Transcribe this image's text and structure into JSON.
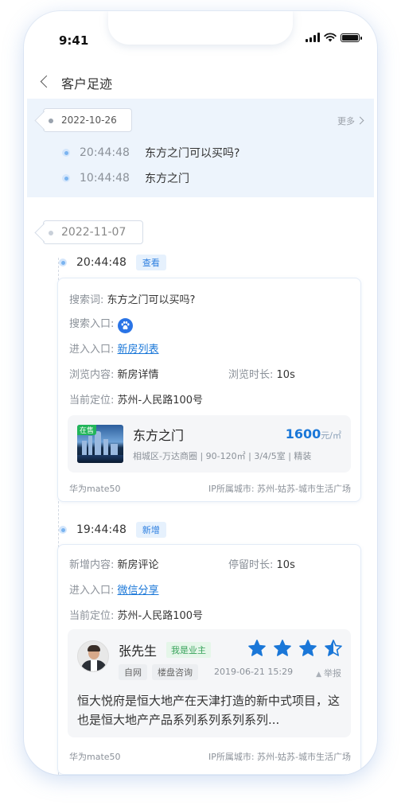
{
  "status": {
    "time": "9:41"
  },
  "nav": {
    "title": "客户足迹"
  },
  "summary": {
    "date": "2022-10-26",
    "more": "更多",
    "visits": [
      {
        "time": "20:44:48",
        "text": "东方之门可以买吗?"
      },
      {
        "time": "10:44:48",
        "text": "东方之门"
      }
    ]
  },
  "day": {
    "date": "2022-11-07",
    "events": [
      {
        "time": "20:44:48",
        "badge": "查看",
        "search_word_label": "搜索词:",
        "search_word": "东方之门可以买吗?",
        "search_entry_label": "搜索入口:",
        "search_entry_icon": "baidu-paw-icon",
        "entry_label": "进入入口:",
        "entry": "新房列表",
        "content_label": "浏览内容:",
        "content": "新房详情",
        "duration_label": "浏览时长:",
        "duration": "10s",
        "location_label": "当前定位:",
        "location": "苏州-人民路100号",
        "house": {
          "status": "在售",
          "name": "东方之门",
          "price": "1600",
          "price_unit": "元/㎡",
          "desc": "相城区-万达商圈 | 90-120㎡ | 3/4/5室 | 精装"
        },
        "device": "华为mate50",
        "ip_city": "IP所属城市: 苏州-姑苏-城市生活广场"
      },
      {
        "time": "19:44:48",
        "badge": "新增",
        "add_content_label": "新增内容:",
        "add_content": "新房评论",
        "stay_label": "停留时长:",
        "stay": "10s",
        "entry_label": "进入入口:",
        "entry": "微信分享",
        "location_label": "当前定位:",
        "location": "苏州-人民路100号",
        "review": {
          "name": "张先生",
          "owner_tag": "我是业主",
          "rating": 3.5,
          "tags": [
            "自网",
            "楼盘咨询"
          ],
          "date": "2019-06-21 15:29",
          "report": "举报",
          "text": "恒大悦府是恒大地产在天津打造的新中式项目，这也是恒大地产产品系列系列系列系列..."
        },
        "device": "华为mate50",
        "ip_city": "IP所属城市: 苏州-姑苏-城市生活广场"
      }
    ]
  },
  "colors": {
    "accent": "#1a77d8",
    "summary_bg": "#edf4fc",
    "owner_green": "#37a25a"
  }
}
